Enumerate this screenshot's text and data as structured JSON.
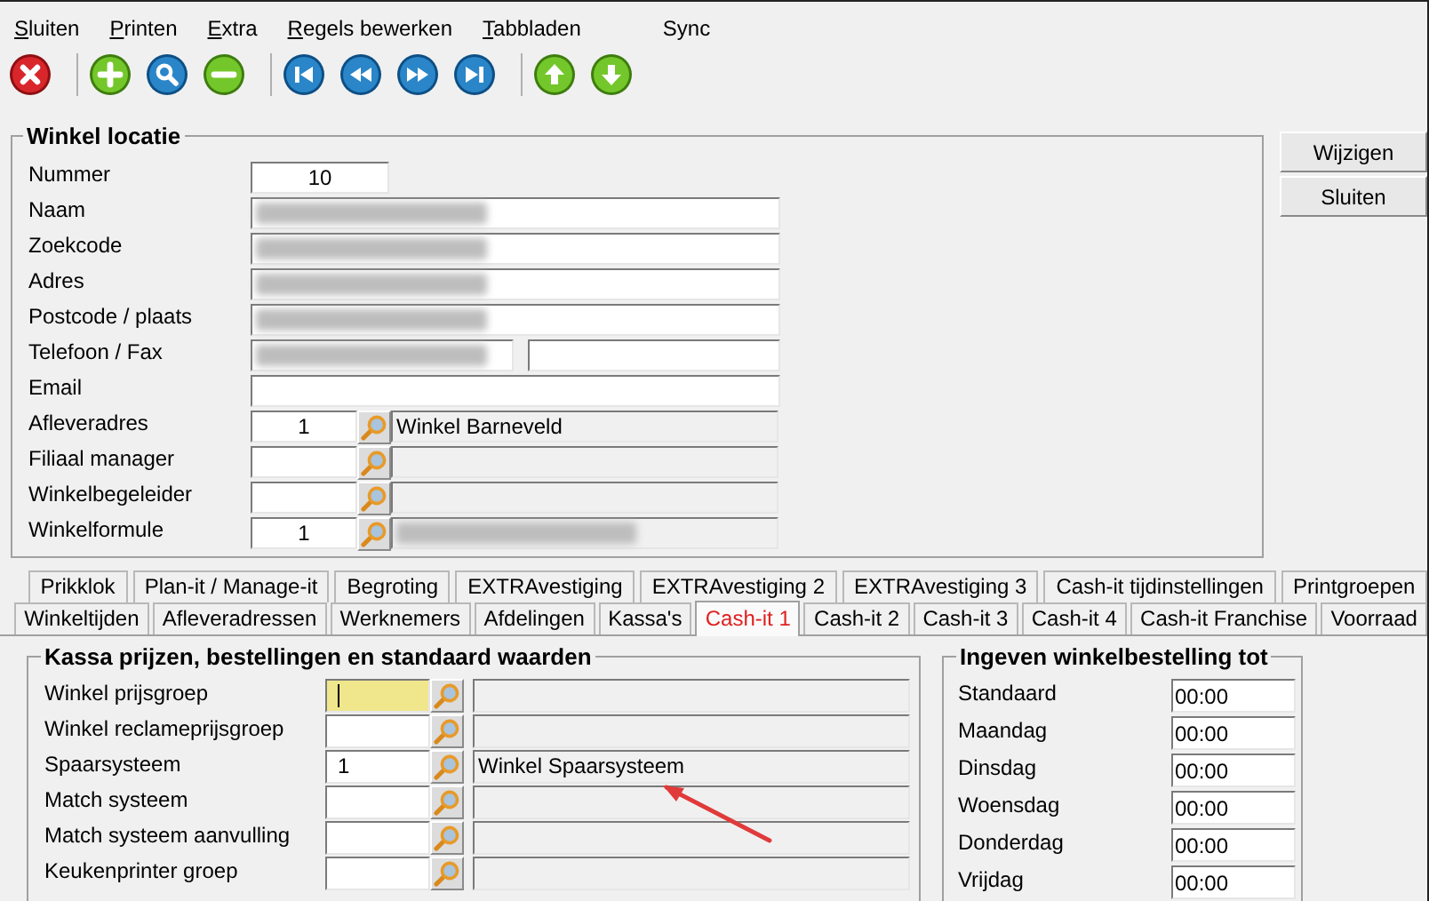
{
  "menu": [
    {
      "label": "Sluiten"
    },
    {
      "label": "Printen"
    },
    {
      "label": "Extra"
    },
    {
      "label": "Regels bewerken"
    },
    {
      "label": "Tabbladen"
    },
    {
      "label": "Sync"
    }
  ],
  "location_group": {
    "title": "Winkel locatie",
    "fields": [
      {
        "label": "Nummer",
        "kind": "number",
        "value": "10"
      },
      {
        "label": "Naam",
        "kind": "text",
        "redacted": true
      },
      {
        "label": "Zoekcode",
        "kind": "text",
        "redacted": true
      },
      {
        "label": "Adres",
        "kind": "text",
        "redacted": true
      },
      {
        "label": "Postcode / plaats",
        "kind": "text",
        "redacted": true
      },
      {
        "label": "Telefoon / Fax",
        "kind": "pair",
        "redacted": true
      },
      {
        "label": "Email",
        "kind": "text",
        "redacted": false
      },
      {
        "label": "Afleveradres",
        "kind": "lookup",
        "code": "1",
        "description": "Winkel Barneveld",
        "redacted": false
      },
      {
        "label": "Filiaal manager",
        "kind": "lookup",
        "redacted": false
      },
      {
        "label": "Winkelbegeleider",
        "kind": "lookup",
        "redacted": false
      },
      {
        "label": "Winkelformule",
        "kind": "lookup",
        "code": "1",
        "redacted": true
      }
    ]
  },
  "buttons": [
    "Wijzigen",
    "Sluiten"
  ],
  "tab_rows": [
    [
      {
        "label": "Prikklok",
        "selected": false
      },
      {
        "label": "Plan-it / Manage-it",
        "selected": false
      },
      {
        "label": "Begroting",
        "selected": false
      },
      {
        "label": "EXTRAvestiging",
        "selected": false
      },
      {
        "label": "EXTRAvestiging 2",
        "selected": false
      },
      {
        "label": "EXTRAvestiging 3",
        "selected": false
      },
      {
        "label": "Cash-it tijdinstellingen",
        "selected": false
      },
      {
        "label": "Printgroepen",
        "selected": false
      }
    ],
    [
      {
        "label": "Winkeltijden",
        "selected": false
      },
      {
        "label": "Afleveradressen",
        "selected": false
      },
      {
        "label": "Werknemers",
        "selected": false
      },
      {
        "label": "Afdelingen",
        "selected": false
      },
      {
        "label": "Kassa's",
        "selected": false
      },
      {
        "label": "Cash-it 1",
        "selected": true
      },
      {
        "label": "Cash-it 2",
        "selected": false
      },
      {
        "label": "Cash-it 3",
        "selected": false
      },
      {
        "label": "Cash-it 4",
        "selected": false
      },
      {
        "label": "Cash-it Franchise",
        "selected": false
      },
      {
        "label": "Voorraad",
        "selected": false
      }
    ]
  ],
  "cash_group": {
    "title": "Kassa prijzen, bestellingen en standaard waarden",
    "fields": [
      {
        "label": "Winkel prijsgroep",
        "focused": true
      },
      {
        "label": "Winkel reclameprijsgroep",
        "focused": false
      },
      {
        "label": "Spaarsysteem",
        "code": "1",
        "description": "Winkel Spaarsysteem",
        "focused": false
      },
      {
        "label": "Match systeem",
        "focused": false
      },
      {
        "label": "Match systeem aanvulling",
        "focused": false
      },
      {
        "label": "Keukenprinter groep",
        "focused": false
      }
    ]
  },
  "order_group": {
    "title": "Ingeven winkelbestelling tot",
    "fields": [
      {
        "label": "Standaard",
        "value": "00:00"
      },
      {
        "label": "Maandag",
        "value": "00:00"
      },
      {
        "label": "Dinsdag",
        "value": "00:00"
      },
      {
        "label": "Woensdag",
        "value": "00:00"
      },
      {
        "label": "Donderdag",
        "value": "00:00"
      },
      {
        "label": "Vrijdag",
        "value": "00:00"
      }
    ]
  }
}
